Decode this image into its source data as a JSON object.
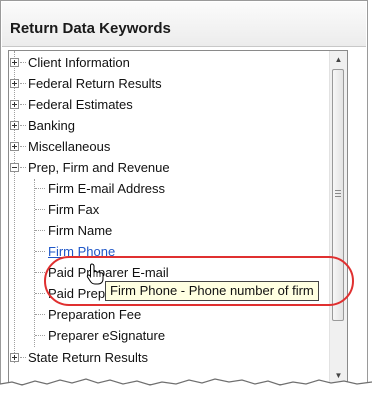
{
  "header": {
    "title": "Return Data Keywords"
  },
  "tree": {
    "items": [
      {
        "label": "Client Information",
        "expanded": false
      },
      {
        "label": "Federal Return Results",
        "expanded": false
      },
      {
        "label": "Federal Estimates",
        "expanded": false
      },
      {
        "label": "Banking",
        "expanded": false
      },
      {
        "label": "Miscellaneous",
        "expanded": false
      },
      {
        "label": "Prep, Firm and Revenue",
        "expanded": true,
        "children": [
          "Firm E-mail Address",
          "Firm Fax",
          "Firm Name",
          "Firm Phone",
          "Paid Preparer E-mail",
          "Paid Preparer Name",
          "Preparation Fee",
          "Preparer eSignature"
        ]
      },
      {
        "label": "State Return Results",
        "expanded": false
      }
    ],
    "selected_child": "Firm Phone"
  },
  "tooltip": {
    "text": "Firm Phone - Phone number of firm"
  },
  "colors": {
    "highlight_ring": "#e03030",
    "link": "#1f57c7",
    "tooltip_bg": "#ffffe1"
  },
  "icons": {
    "expand": "plus-box-icon",
    "collapse": "minus-box-icon",
    "cursor": "hand-pointer-icon",
    "scroll_up": "up-arrow-icon",
    "scroll_down": "down-arrow-icon"
  }
}
